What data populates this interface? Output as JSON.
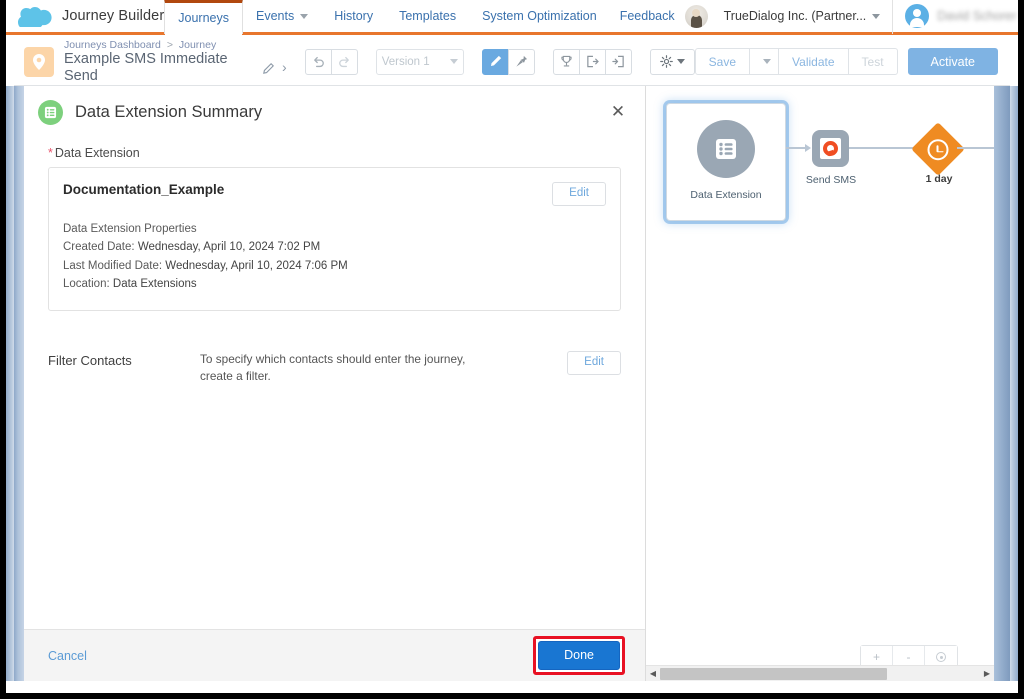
{
  "topnav": {
    "brand": "Journey Builder",
    "tabs": [
      {
        "label": "Journeys",
        "active": true,
        "has_caret": false
      },
      {
        "label": "Events",
        "active": false,
        "has_caret": true
      },
      {
        "label": "History",
        "active": false,
        "has_caret": false
      },
      {
        "label": "Templates",
        "active": false,
        "has_caret": false
      },
      {
        "label": "System Optimization",
        "active": false,
        "has_caret": false
      }
    ],
    "feedback": "Feedback",
    "org": "TrueDialog Inc. (Partner...",
    "user": "David Schorer"
  },
  "toolbar": {
    "breadcrumb_parent": "Journeys Dashboard",
    "breadcrumb_sep": ">",
    "breadcrumb_child": "Journey",
    "journey_title": "Example SMS Immediate Send",
    "version": "Version 1",
    "save": "Save",
    "validate": "Validate",
    "test": "Test",
    "activate": "Activate"
  },
  "panel": {
    "title": "Data Extension Summary",
    "field_label": "Data Extension",
    "required_mark": "*",
    "data_extension": {
      "name": "Documentation_Example",
      "edit_label": "Edit",
      "properties_header": "Data Extension Properties",
      "rows": [
        {
          "key": "Created Date:",
          "value": "Wednesday, April 10, 2024 7:02 PM"
        },
        {
          "key": "Last Modified Date:",
          "value": "Wednesday, April 10, 2024 7:06 PM"
        },
        {
          "key": "Location:",
          "value": "Data Extensions"
        }
      ]
    },
    "filter": {
      "label": "Filter Contacts",
      "description": "To specify which contacts should enter the journey, create a filter.",
      "edit_label": "Edit"
    },
    "footer": {
      "cancel": "Cancel",
      "done": "Done",
      "done_highlight_color": "#e81123"
    }
  },
  "canvas": {
    "nodes": [
      {
        "id": "data-extension",
        "label": "Data Extension",
        "type": "entry-source",
        "selected": true
      },
      {
        "id": "send-sms",
        "label": "Send SMS",
        "type": "activity"
      },
      {
        "id": "wait",
        "label": "1 day",
        "type": "wait"
      }
    ],
    "zoom_controls": [
      {
        "name": "zoom-in",
        "glyph": "+"
      },
      {
        "name": "zoom-out",
        "glyph": "-"
      },
      {
        "name": "zoom-reset",
        "glyph": ""
      }
    ]
  },
  "colors": {
    "brand_orange": "#e8762d",
    "tab_active_top": "#b1480e",
    "link_blue": "#3a71ad",
    "done_blue": "#1976d2",
    "highlight_red": "#e81123",
    "wait_orange": "#ef8b22",
    "sms_red": "#f04e23",
    "node_gray": "#9aa7b4",
    "green_badge": "#7dd07d"
  }
}
